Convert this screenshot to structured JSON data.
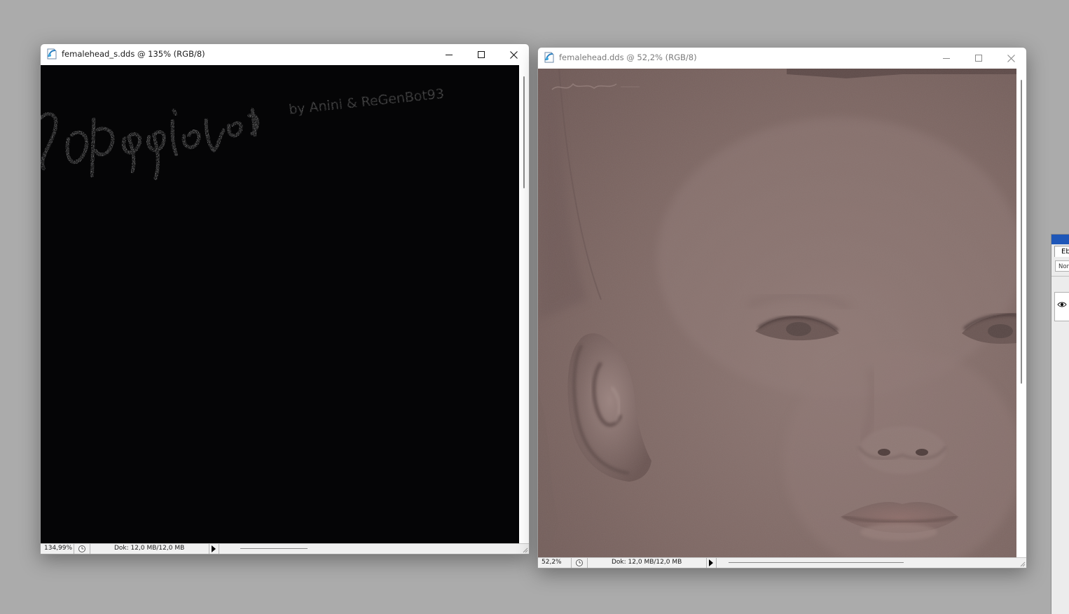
{
  "windows": [
    {
      "title": "femalehead_s.dds @ 135% (RGB/8)",
      "watermark": "by Anini & ReGenBot93",
      "status": {
        "zoom": "134,99%",
        "doc_size": "Dok: 12,0 MB/12,0 MB"
      }
    },
    {
      "title": "femalehead.dds @ 52,2% (RGB/8)",
      "status": {
        "zoom": "52,2%",
        "doc_size": "Dok: 12,0 MB/12,0 MB"
      }
    }
  ],
  "layers_panel": {
    "tab_label": "Eb",
    "blend_mode": "Nor"
  },
  "icons": {
    "app": "photoshop-document-icon",
    "minimize": "minimize-icon",
    "maximize": "maximize-icon",
    "close": "close-icon",
    "status": "timing-icon",
    "menu": "triangle-right-icon",
    "visibility": "eye-icon"
  },
  "colors": {
    "desktop": "#ababab",
    "canvas_specular": "#050506",
    "skin": "#7a6461",
    "panel_header": "#1f57b8"
  }
}
